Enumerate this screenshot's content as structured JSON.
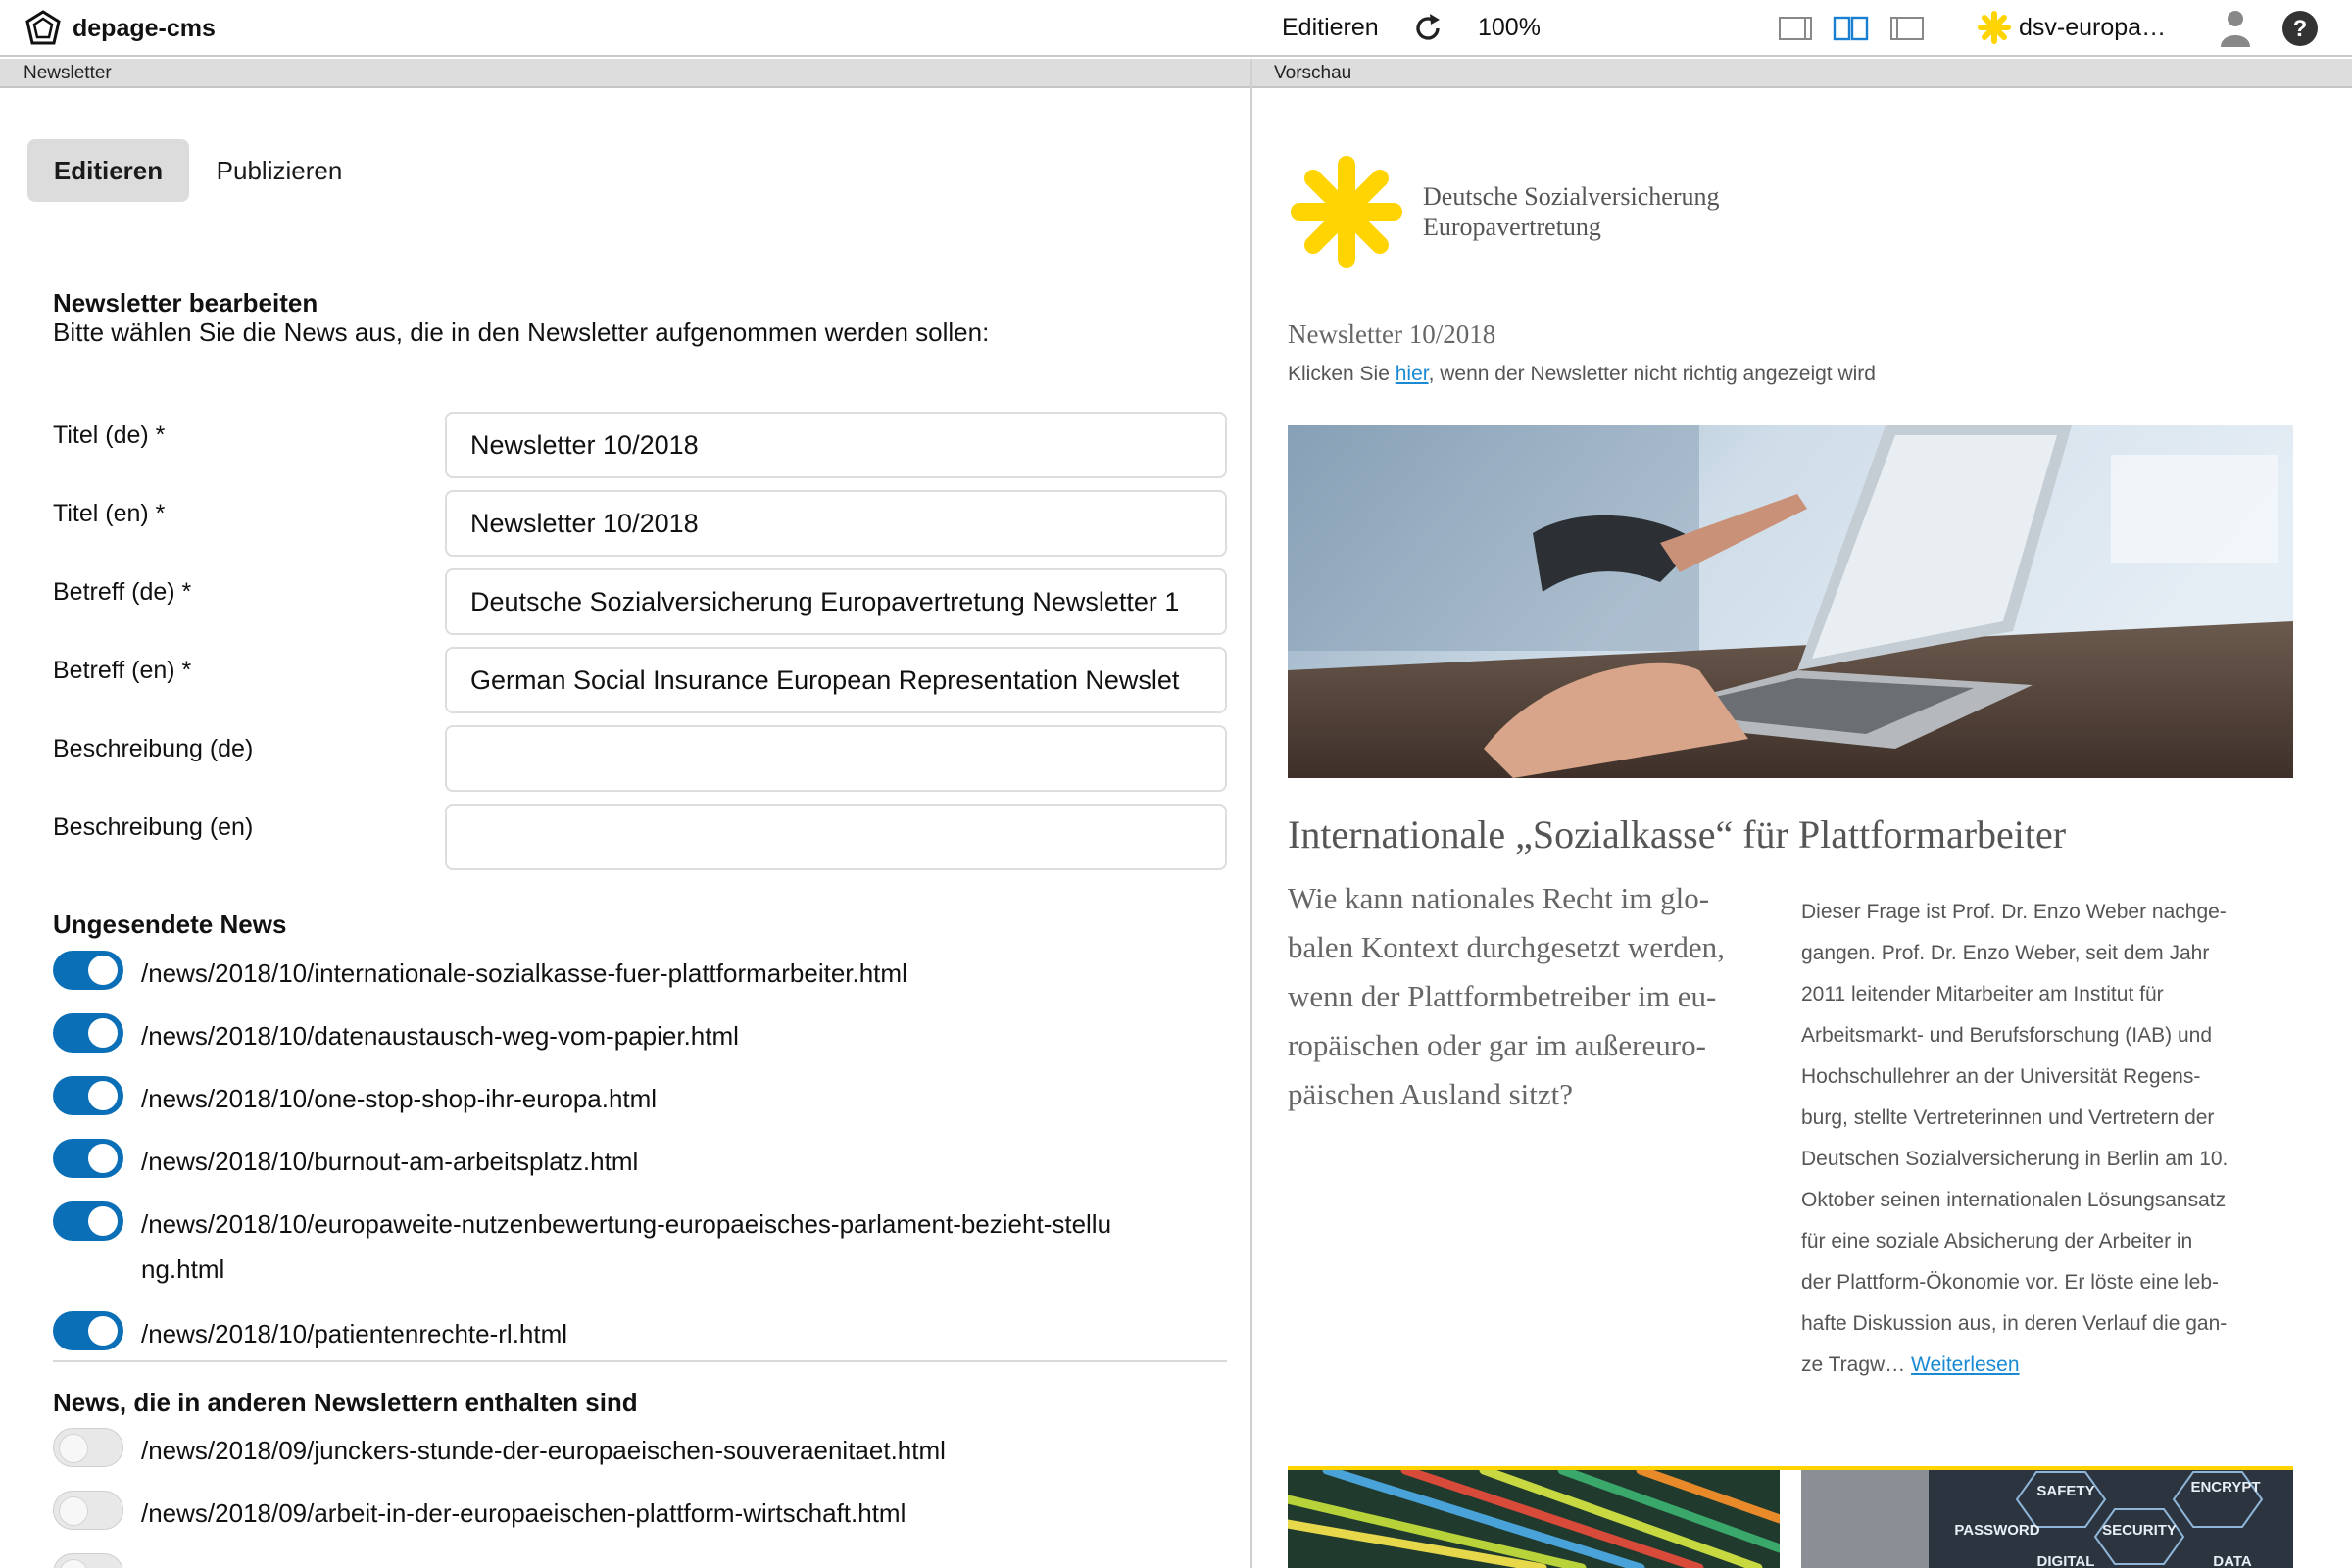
{
  "app": {
    "name": "depage-cms"
  },
  "toolbar": {
    "edit_label": "Editieren",
    "zoom": "100%",
    "project_label": "dsv-europa…",
    "colors": {
      "accent": "#0b6fb8",
      "star": "#ffd400"
    }
  },
  "panels": {
    "left_title": "Newsletter",
    "right_title": "Vorschau"
  },
  "tabs": {
    "edit": "Editieren",
    "publish": "Publizieren"
  },
  "editor": {
    "heading": "Newsletter bearbeiten",
    "subheading": "Bitte wählen Sie die News aus, die in den Newsletter aufgenommen werden sollen:",
    "fields": [
      {
        "label": "Titel (de) *",
        "value": "Newsletter 10/2018"
      },
      {
        "label": "Titel (en) *",
        "value": "Newsletter 10/2018"
      },
      {
        "label": "Betreff (de) *",
        "value": "Deutsche Sozialversicherung Europavertretung Newsletter 1"
      },
      {
        "label": "Betreff (en) *",
        "value": "German Social Insurance European Representation Newslet"
      },
      {
        "label": "Beschreibung (de)",
        "value": ""
      },
      {
        "label": "Beschreibung (en)",
        "value": ""
      }
    ],
    "unsent_heading": "Ungesendete News",
    "unsent": [
      {
        "path": "/news/2018/10/internationale-sozialkasse-fuer-plattformarbeiter.html",
        "checked": true
      },
      {
        "path": "/news/2018/10/datenaustausch-weg-vom-papier.html",
        "checked": true
      },
      {
        "path": "/news/2018/10/one-stop-shop-ihr-europa.html",
        "checked": true
      },
      {
        "path": "/news/2018/10/burnout-am-arbeitsplatz.html",
        "checked": true
      },
      {
        "path": "/news/2018/10/europaweite-nutzenbewertung-europaeisches-parlament-bezieht-stellung.html",
        "checked": true
      },
      {
        "path": "/news/2018/10/patientenrechte-rl.html",
        "checked": true
      }
    ],
    "other_heading": "News, die in anderen Newslettern enthalten sind",
    "other": [
      {
        "path": "/news/2018/09/junckers-stunde-der-europaeischen-souveraenitaet.html",
        "checked": false
      },
      {
        "path": "/news/2018/09/arbeit-in-der-europaeischen-plattform-wirtschaft.html",
        "checked": false
      },
      {
        "path": "",
        "checked": false
      }
    ]
  },
  "preview": {
    "org_line1": "Deutsche Sozialversicherung",
    "org_line2": "Europavertretung",
    "issue": "Newsletter 10/2018",
    "notice_before": "Klicken Sie ",
    "notice_link": "hier",
    "notice_after": ", wenn der Newsletter nicht richtig angezeigt wird",
    "article_title": "Internationale „Sozialkasse“ für Plattformarbeiter",
    "lead_lines": [
      "Wie kann nationales Recht im glo-",
      "balen Kontext durchgesetzt werden,",
      "wenn der Plattformbetreiber im eu-",
      "ropäischen oder gar im außereuro-",
      "päischen Ausland sitzt?"
    ],
    "body_lines": [
      "Dieser Frage ist Prof. Dr. Enzo Weber nachge-",
      "gangen. Prof. Dr. Enzo Weber, seit dem Jahr",
      "2011 leitender Mitarbeiter am Institut für",
      "Arbeitsmarkt- und Berufsforschung (IAB) und",
      "Hochschullehrer an der Universität Regens-",
      "burg, stellte Vertreterinnen und Vertretern der",
      "Deutschen Sozialversicherung in Berlin am 10.",
      "Oktober seinen internationalen Lösungsansatz",
      "für eine soziale Absicherung der Arbeiter in",
      "der Plattform-Ökonomie vor. Er löste eine leb-",
      "hafte Diskussion aus, in deren Verlauf die gan-"
    ],
    "body_last": "ze Tragw… ",
    "read_more": "Weiterlesen",
    "thumb2_words": [
      "SAFETY",
      "ENCRYPT",
      "PASSWORD",
      "SECURITY",
      "DIGITAL",
      "DATA"
    ]
  }
}
